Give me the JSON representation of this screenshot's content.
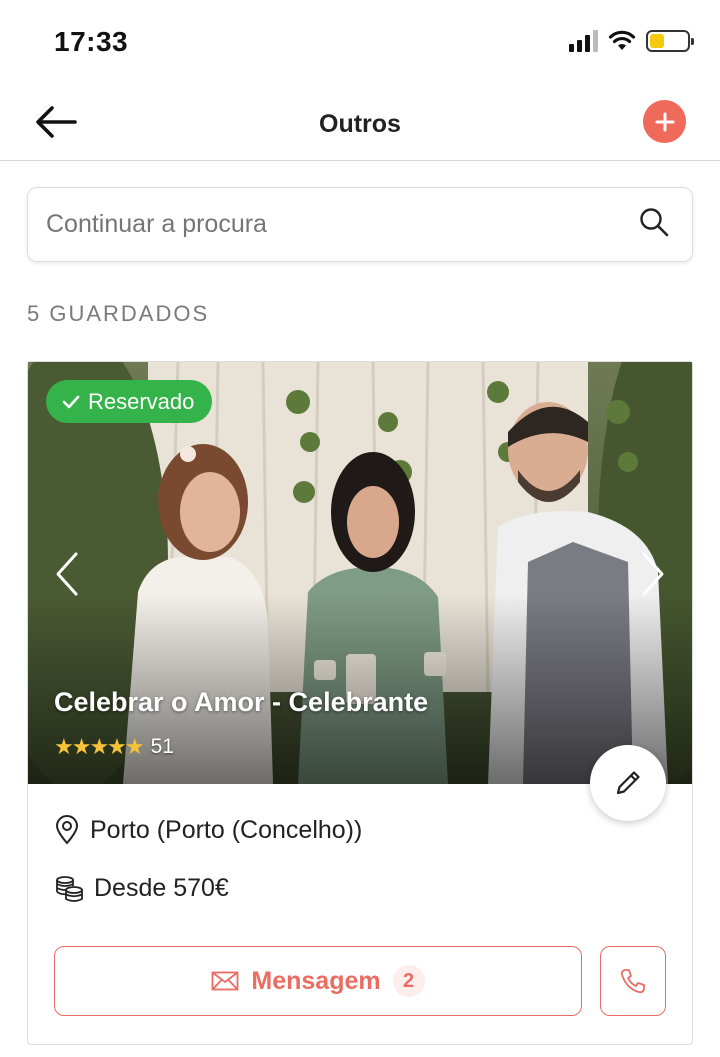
{
  "status_bar": {
    "time": "17:33"
  },
  "header": {
    "title": "Outros"
  },
  "search": {
    "placeholder": "Continuar a procura"
  },
  "saved": {
    "label": "5 GUARDADOS"
  },
  "card": {
    "badge": "Reservado",
    "name": "Celebrar o Amor - Celebrante",
    "stars": "★★★★★",
    "rating": 5,
    "review_count": "51",
    "location": "Porto (Porto (Concelho))",
    "price": "Desde 570€",
    "message_label": "Mensagem",
    "message_count": "2"
  },
  "colors": {
    "accent": "#ef6a5b",
    "badge_green": "#34b34a",
    "star": "#f5c23a"
  },
  "icons": [
    "back-arrow-icon",
    "plus-icon",
    "search-icon",
    "check-icon",
    "chevron-left-icon",
    "chevron-right-icon",
    "pencil-icon",
    "location-pin-icon",
    "coins-icon",
    "envelope-icon",
    "phone-icon",
    "signal-icon",
    "wifi-icon",
    "battery-icon"
  ]
}
